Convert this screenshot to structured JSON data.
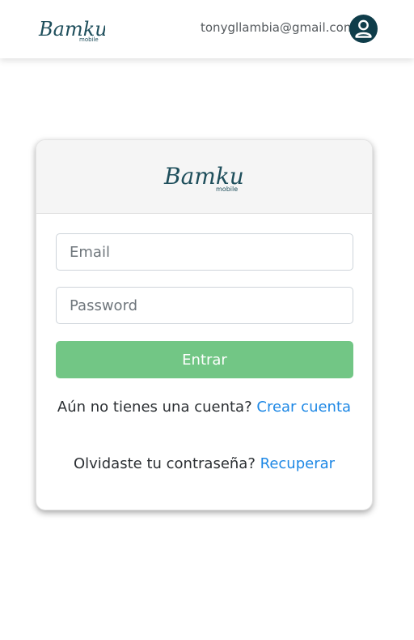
{
  "navbar": {
    "brand_text": "Bamku",
    "brand_sub": "mobile",
    "user_email": "tonygllambia@gmail.com",
    "avatar_icon": "user-icon"
  },
  "login_card": {
    "logo_text": "Bamku",
    "logo_sub": "mobile",
    "email_placeholder": "Email",
    "password_placeholder": "Password",
    "submit_label": "Entrar",
    "register_prompt": "Aún no tienes una cuenta?",
    "register_link": "Crear cuenta",
    "recover_prompt": "Olvidaste tu contraseña?",
    "recover_link": "Recuperar"
  },
  "colors": {
    "brand_dark": "#0f3d4a",
    "submit_green": "#72c685",
    "link_blue": "#1e88e5"
  }
}
